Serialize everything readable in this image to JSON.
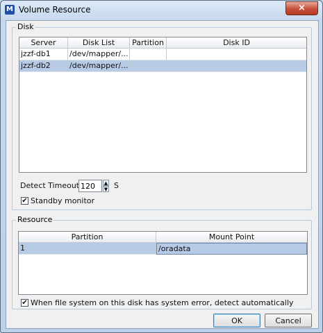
{
  "window": {
    "title": "Volume Resource",
    "app_icon_glyph": "M",
    "close_glyph": "×"
  },
  "disk": {
    "group_label": "Disk",
    "columns": [
      "Server",
      "Disk List",
      "Partition",
      "Disk ID"
    ],
    "rows": [
      {
        "server": "jzzf-db1",
        "disk_list": "/dev/mapper/...",
        "partition": "",
        "disk_id": "",
        "selected": false
      },
      {
        "server": "jzzf-db2",
        "disk_list": "/dev/mapper/...",
        "partition": "",
        "disk_id": "",
        "selected": true
      }
    ],
    "detect_timeout_label": "Detect Timeout",
    "detect_timeout_value": "120",
    "detect_timeout_unit": "S",
    "standby_monitor_label": "Standby monitor",
    "standby_monitor_checked": true
  },
  "resource": {
    "group_label": "Resource",
    "columns": [
      "Partition",
      "Mount Point"
    ],
    "rows": [
      {
        "partition": "1",
        "mount_point": "/oradata",
        "selected": true
      }
    ],
    "auto_detect_label": "When file system on this disk has system error, detect automatically",
    "auto_detect_checked": true
  },
  "buttons": {
    "ok": "OK",
    "cancel": "Cancel"
  },
  "colors": {
    "selection": "#b7cbe6",
    "close_button": "#c7503a"
  }
}
